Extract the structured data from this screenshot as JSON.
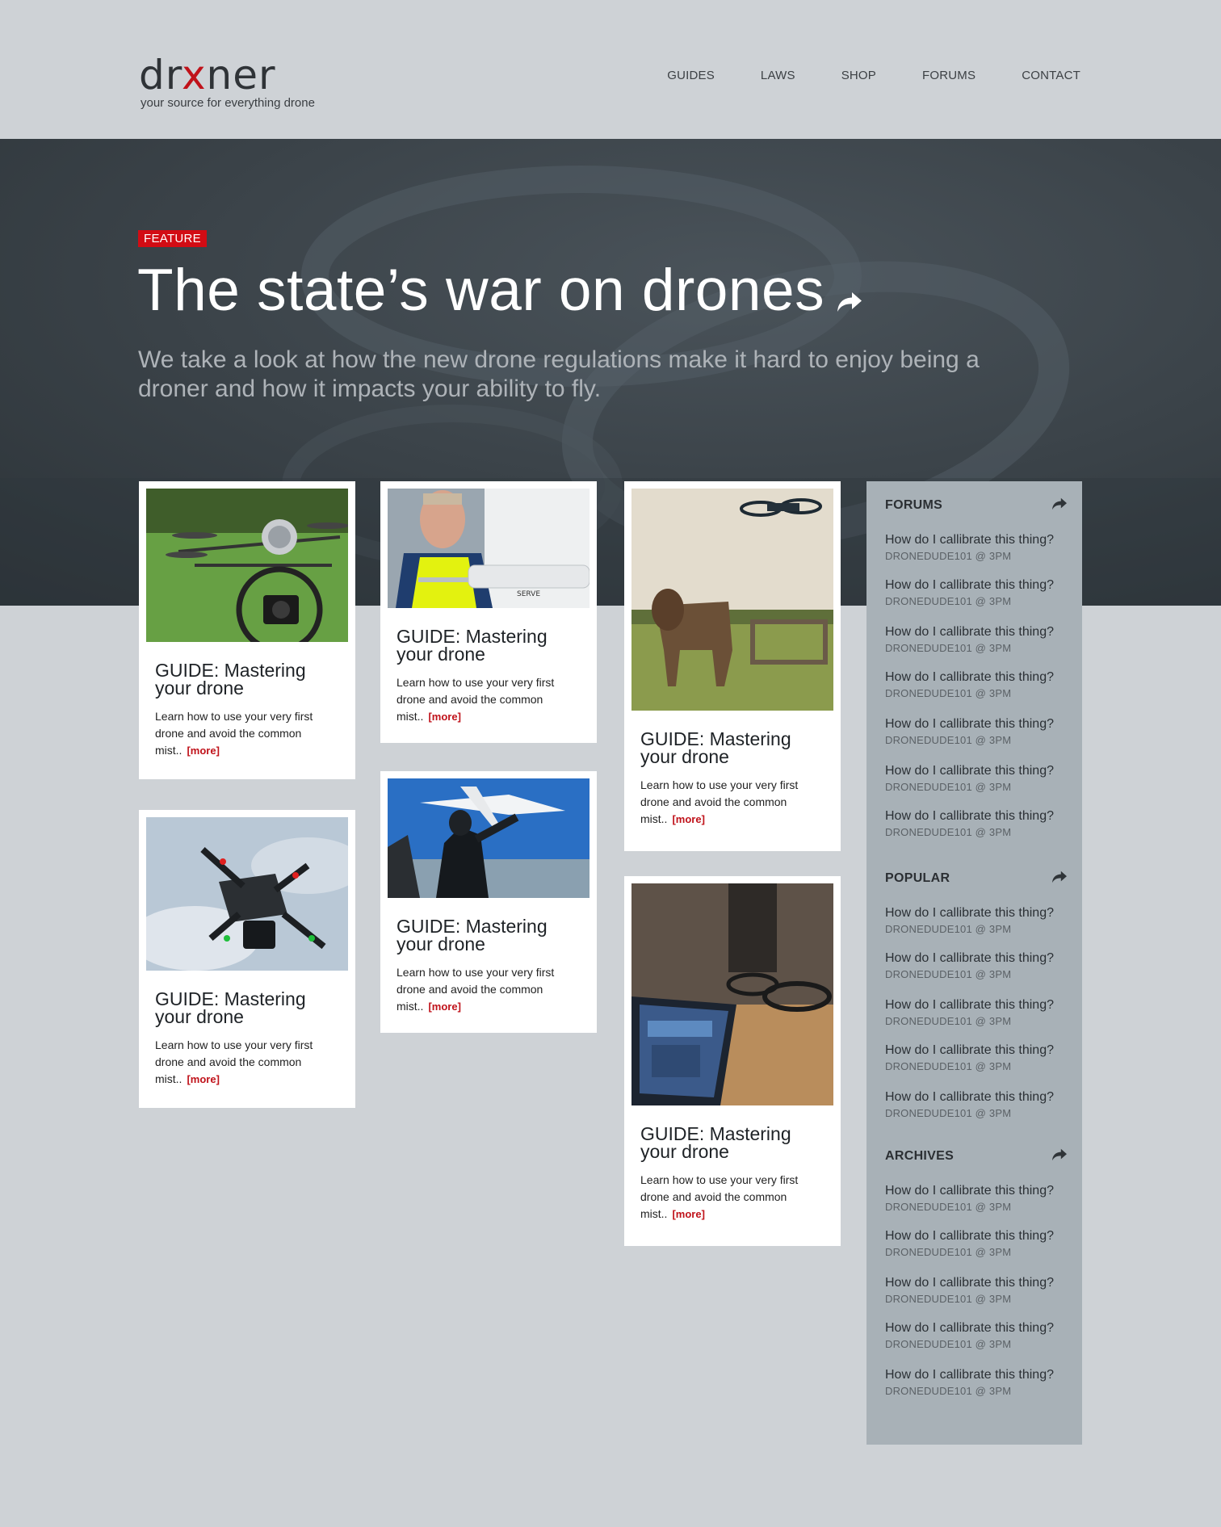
{
  "brand": {
    "logo_pre": "dr",
    "logo_x": "x",
    "logo_post": "ner",
    "tagline": "your source for everything drone"
  },
  "nav": [
    "GUIDES",
    "LAWS",
    "SHOP",
    "FORUMS",
    "CONTACT"
  ],
  "hero": {
    "tag": "FEATURE",
    "title": "The state’s war on drones",
    "subtitle": "We take a look at how the new drone regulations make it hard to enjoy being a droner and how it impacts your ability to fly."
  },
  "cards": [
    {
      "title": "GUIDE: Mastering your drone",
      "desc": "Learn how to use your very first drone and avoid the common mist..",
      "more": "[more]",
      "image": "octocopter-camera-on-grass"
    },
    {
      "title": "GUIDE: Mastering your drone",
      "desc": "Learn how to use your very first drone and avoid the common mist..",
      "more": "[more]",
      "image": "man-in-safety-vest-with-drone"
    },
    {
      "title": "GUIDE: Mastering your drone",
      "desc": "Learn how to use your very first drone and avoid the common mist..",
      "more": "[more]",
      "image": "cow-and-quadcopter"
    },
    {
      "title": "GUIDE: Mastering your drone",
      "desc": "Learn how to use your very first drone and avoid the common mist..",
      "more": "[more]",
      "image": "quadcopter-in-clouds"
    },
    {
      "title": "GUIDE: Mastering your drone",
      "desc": "Learn how to use your very first drone and avoid the common mist..",
      "more": "[more]",
      "image": "men-launching-fixed-wing-drone"
    },
    {
      "title": "GUIDE: Mastering your drone",
      "desc": "Learn how to use your very first drone and avoid the common mist..",
      "more": "[more]",
      "image": "tablet-controlling-drone"
    }
  ],
  "sidebar": {
    "sections": [
      {
        "title": "FORUMS",
        "items": [
          {
            "q": "How do I callibrate this thing?",
            "meta": "DRONEDUDE101 @ 3PM"
          },
          {
            "q": "How do I callibrate this thing?",
            "meta": "DRONEDUDE101 @ 3PM"
          },
          {
            "q": "How do I callibrate this thing?",
            "meta": "DRONEDUDE101 @ 3PM"
          },
          {
            "q": "How do I callibrate this thing?",
            "meta": "DRONEDUDE101 @ 3PM"
          },
          {
            "q": "How do I callibrate this thing?",
            "meta": "DRONEDUDE101 @ 3PM"
          },
          {
            "q": "How do I callibrate this thing?",
            "meta": "DRONEDUDE101 @ 3PM"
          },
          {
            "q": "How do I callibrate this thing?",
            "meta": "DRONEDUDE101 @ 3PM"
          }
        ]
      },
      {
        "title": "POPULAR",
        "items": [
          {
            "q": "How do I callibrate this thing?",
            "meta": "DRONEDUDE101 @ 3PM"
          },
          {
            "q": "How do I callibrate this thing?",
            "meta": "DRONEDUDE101 @ 3PM"
          },
          {
            "q": "How do I callibrate this thing?",
            "meta": "DRONEDUDE101 @ 3PM"
          },
          {
            "q": "How do I callibrate this thing?",
            "meta": "DRONEDUDE101 @ 3PM"
          },
          {
            "q": "How do I callibrate this thing?",
            "meta": "DRONEDUDE101 @ 3PM"
          }
        ]
      },
      {
        "title": "ARCHIVES",
        "items": [
          {
            "q": "How do I callibrate this thing?",
            "meta": "DRONEDUDE101 @ 3PM"
          },
          {
            "q": "How do I callibrate this thing?",
            "meta": "DRONEDUDE101 @ 3PM"
          },
          {
            "q": "How do I callibrate this thing?",
            "meta": "DRONEDUDE101 @ 3PM"
          },
          {
            "q": "How do I callibrate this thing?",
            "meta": "DRONEDUDE101 @ 3PM"
          },
          {
            "q": "How do I callibrate this thing?",
            "meta": "DRONEDUDE101 @ 3PM"
          }
        ]
      }
    ]
  },
  "colors": {
    "accent": "#d20c14",
    "page_bg": "#ced2d6",
    "hero_bg": "#3b4349",
    "sidebar_bg": "#a8b1b7"
  }
}
